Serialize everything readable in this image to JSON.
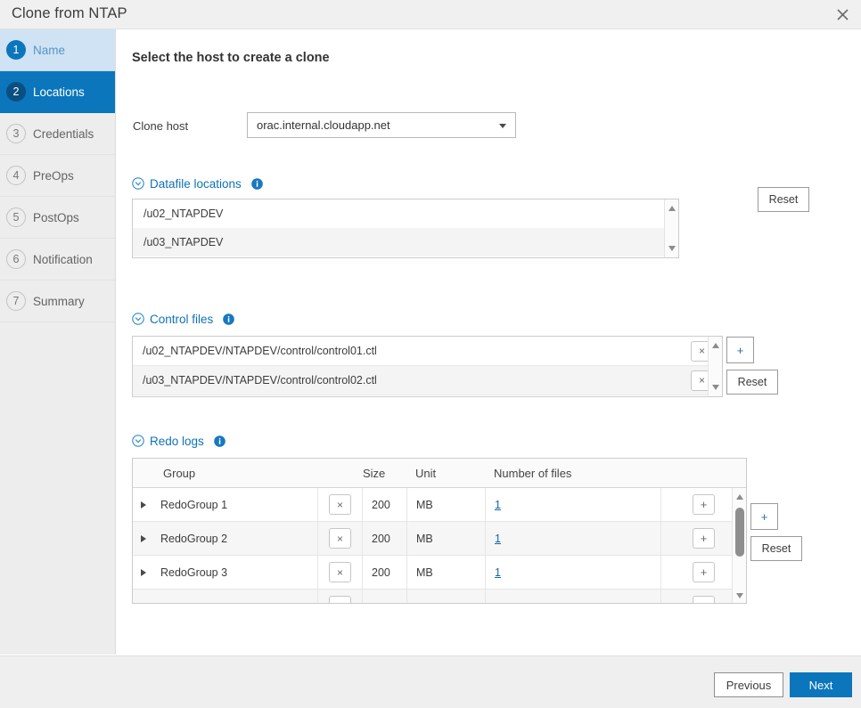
{
  "window": {
    "title": "Clone from NTAP",
    "close_icon": "close-icon"
  },
  "sidebar": {
    "steps": [
      {
        "num": "1",
        "label": "Name",
        "state": "done"
      },
      {
        "num": "2",
        "label": "Locations",
        "state": "active"
      },
      {
        "num": "3",
        "label": "Credentials",
        "state": "pending"
      },
      {
        "num": "4",
        "label": "PreOps",
        "state": "pending"
      },
      {
        "num": "5",
        "label": "PostOps",
        "state": "pending"
      },
      {
        "num": "6",
        "label": "Notification",
        "state": "pending"
      },
      {
        "num": "7",
        "label": "Summary",
        "state": "pending"
      }
    ]
  },
  "main": {
    "pane_title": "Select the host to create a clone",
    "clone_host": {
      "label": "Clone host",
      "value": "orac.internal.cloudapp.net",
      "caret_icon": "chevron-down-icon"
    },
    "datafile_locations": {
      "title": "Datafile locations",
      "collapse_icon": "collapse-circle-chevron-icon",
      "info_icon": "info-icon",
      "rows": [
        "/u02_NTAPDEV",
        "/u03_NTAPDEV"
      ],
      "reset_label": "Reset",
      "scroll_up_icon": "scroll-up-arrow-icon",
      "scroll_down_icon": "scroll-down-arrow-icon"
    },
    "control_files": {
      "title": "Control files",
      "collapse_icon": "collapse-circle-chevron-icon",
      "info_icon": "info-icon",
      "rows": [
        "/u02_NTAPDEV/NTAPDEV/control/control01.ctl",
        "/u03_NTAPDEV/NTAPDEV/control/control02.ctl"
      ],
      "delete_label": "×",
      "add_label": "+",
      "reset_label": "Reset",
      "scroll_up_icon": "scroll-up-arrow-icon",
      "scroll_down_icon": "scroll-down-arrow-icon"
    },
    "redo_logs": {
      "title": "Redo logs",
      "collapse_icon": "collapse-circle-chevron-icon",
      "info_icon": "info-icon",
      "columns": [
        "Group",
        "Size",
        "Unit",
        "Number of files"
      ],
      "rows": [
        {
          "group": "RedoGroup 1",
          "size": "200",
          "unit": "MB",
          "files": "1"
        },
        {
          "group": "RedoGroup 2",
          "size": "200",
          "unit": "MB",
          "files": "1"
        },
        {
          "group": "RedoGroup 3",
          "size": "200",
          "unit": "MB",
          "files": "1"
        }
      ],
      "delete_label": "×",
      "add_label": "+",
      "reset_label": "Reset",
      "expand_icon": "expand-triangle-icon",
      "scroll_up_icon": "scroll-up-arrow-icon",
      "scroll_down_icon": "scroll-down-arrow-icon"
    }
  },
  "footer": {
    "previous_label": "Previous",
    "next_label": "Next"
  },
  "colors": {
    "accent": "#0b76bc",
    "accent_dark": "#0a4f80",
    "step_done_bg": "#cfe3f5",
    "link": "#1265a8",
    "section_title": "#0f72b5",
    "chrome_bg": "#f0f0f0",
    "sidebar_bg": "#ededed",
    "footer_bg": "#efefef"
  }
}
